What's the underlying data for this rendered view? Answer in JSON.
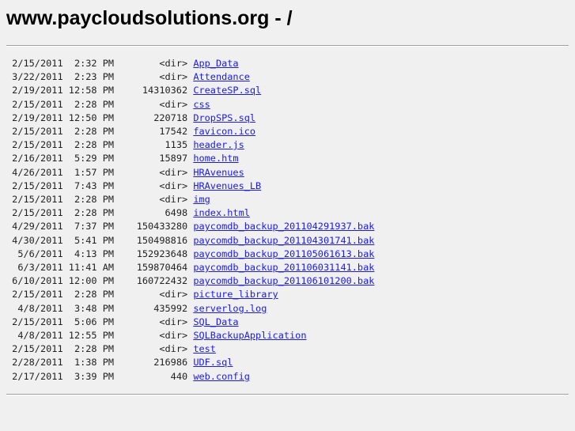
{
  "title": "www.paycloudsolutions.org - /",
  "entries": [
    {
      "date": "2/15/2011",
      "time": "2:32 PM",
      "size": "<dir>",
      "name": "App_Data"
    },
    {
      "date": "3/22/2011",
      "time": "2:23 PM",
      "size": "<dir>",
      "name": "Attendance"
    },
    {
      "date": "2/19/2011",
      "time": "12:58 PM",
      "size": "14310362",
      "name": "CreateSP.sql"
    },
    {
      "date": "2/15/2011",
      "time": "2:28 PM",
      "size": "<dir>",
      "name": "css"
    },
    {
      "date": "2/19/2011",
      "time": "12:50 PM",
      "size": "220718",
      "name": "DropSPS.sql"
    },
    {
      "date": "2/15/2011",
      "time": "2:28 PM",
      "size": "17542",
      "name": "favicon.ico"
    },
    {
      "date": "2/15/2011",
      "time": "2:28 PM",
      "size": "1135",
      "name": "header.js"
    },
    {
      "date": "2/16/2011",
      "time": "5:29 PM",
      "size": "15897",
      "name": "home.htm"
    },
    {
      "date": "4/26/2011",
      "time": "1:57 PM",
      "size": "<dir>",
      "name": "HRAvenues"
    },
    {
      "date": "2/15/2011",
      "time": "7:43 PM",
      "size": "<dir>",
      "name": "HRAvenues_LB"
    },
    {
      "date": "2/15/2011",
      "time": "2:28 PM",
      "size": "<dir>",
      "name": "img"
    },
    {
      "date": "2/15/2011",
      "time": "2:28 PM",
      "size": "6498",
      "name": "index.html"
    },
    {
      "date": "4/29/2011",
      "time": "7:37 PM",
      "size": "150433280",
      "name": "paycomdb_backup_201104291937.bak"
    },
    {
      "date": "4/30/2011",
      "time": "5:41 PM",
      "size": "150498816",
      "name": "paycomdb_backup_201104301741.bak"
    },
    {
      "date": "5/6/2011",
      "time": "4:13 PM",
      "size": "152923648",
      "name": "paycomdb_backup_201105061613.bak"
    },
    {
      "date": "6/3/2011",
      "time": "11:41 AM",
      "size": "159870464",
      "name": "paycomdb_backup_201106031141.bak"
    },
    {
      "date": "6/10/2011",
      "time": "12:00 PM",
      "size": "160722432",
      "name": "paycomdb_backup_201106101200.bak"
    },
    {
      "date": "2/15/2011",
      "time": "2:28 PM",
      "size": "<dir>",
      "name": "picture_library"
    },
    {
      "date": "4/8/2011",
      "time": "3:48 PM",
      "size": "435992",
      "name": "serverlog.log"
    },
    {
      "date": "2/15/2011",
      "time": "5:06 PM",
      "size": "<dir>",
      "name": "SQL_Data"
    },
    {
      "date": "4/8/2011",
      "time": "12:55 PM",
      "size": "<dir>",
      "name": "SQLBackupApplication"
    },
    {
      "date": "2/15/2011",
      "time": "2:28 PM",
      "size": "<dir>",
      "name": "test"
    },
    {
      "date": "2/28/2011",
      "time": "1:38 PM",
      "size": "216986",
      "name": "UDF.sql"
    },
    {
      "date": "2/17/2011",
      "time": "3:39 PM",
      "size": "440",
      "name": "web.config"
    }
  ]
}
